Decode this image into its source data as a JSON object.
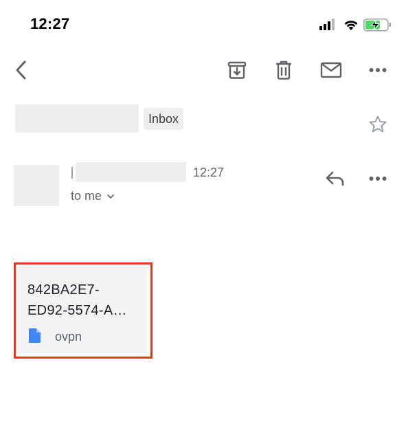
{
  "status_bar": {
    "time": "12:27",
    "icons": [
      "signal-icon",
      "wifi-icon",
      "battery-charging-icon"
    ],
    "battery_color": "#4cd964"
  },
  "toolbar": {
    "icons": [
      "back-icon",
      "archive-icon",
      "trash-icon",
      "mail-icon",
      "more-icon"
    ]
  },
  "subject": {
    "label": "Inbox"
  },
  "message": {
    "time": "12:27",
    "recipient": "to me",
    "icons": [
      "reply-icon",
      "more-icon"
    ]
  },
  "attachment": {
    "name_line1": "842BA2E7-",
    "name_line2": "ED92-5574-A…",
    "type": "ovpn",
    "icon": "file-icon",
    "icon_color": "#4285f4",
    "highlight_color": "#e8361f"
  },
  "colors": {
    "redacted": "#eeeeee",
    "secondary_text": "#5f6368",
    "icon_gray": "#5f6368"
  }
}
